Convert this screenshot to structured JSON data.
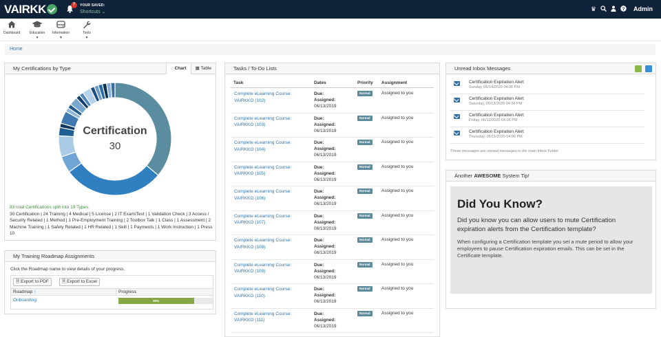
{
  "topbar": {
    "logo": "VAIRKK",
    "notif_count": "7",
    "saved_label": "YOUR SAVED:",
    "shortcuts_label": "Shortcuts",
    "user_name": "Admin"
  },
  "nav": {
    "items": [
      {
        "label": "Dashboard",
        "icon": "home-icon"
      },
      {
        "label": "Education",
        "icon": "graduation-cap-icon"
      },
      {
        "label": "Information",
        "icon": "drive-icon"
      },
      {
        "label": "Tools",
        "icon": "wrench-icon"
      }
    ]
  },
  "breadcrumb": {
    "home": "Home"
  },
  "certs": {
    "title": "My Certifications by Type",
    "tab_chart": "Chart",
    "tab_table": "Table",
    "center_label": "Certification",
    "center_value": "30",
    "summary_lead": "83 total Certifications split into 19 Types.",
    "summary_body": "30 Certification | 24 Training | 4 Medical | 5 License | 2 IT Exam/Test | 1 Validation Check | 3 Access / Security Related | 1 Method | 1 Pre-Employment Training | 2 Toolbox Talk | 1 Class | 1 Assessment | 2 Machine Training | 1 Safety Related | 1 HR Related | 1 Skill | 1 Payments | 1 Work Instruction | 1 Press 10"
  },
  "chart_data": {
    "type": "pie",
    "title": "",
    "categories": [
      "Certification",
      "Training",
      "Medical",
      "License",
      "IT Exam/Test",
      "Validation Check",
      "Access / Security Related",
      "Method",
      "Pre-Employment Training",
      "Toolbox Talk",
      "Class",
      "Assessment",
      "Machine Training",
      "Safety Related",
      "HR Related",
      "Skill",
      "Payments",
      "Work Instruction",
      "Press 10"
    ],
    "values": [
      30,
      24,
      4,
      5,
      2,
      1,
      3,
      1,
      1,
      2,
      1,
      1,
      2,
      1,
      1,
      1,
      1,
      1,
      1
    ],
    "colors": [
      "#5a8da0",
      "#2f7fc1",
      "#6ea5d4",
      "#a9cbe6",
      "#1f5f96",
      "#0e3a62",
      "#3f79b0",
      "#93b6d9",
      "#245a8c",
      "#7aa7cf",
      "#153f69",
      "#4f86bb",
      "#b6d2ea",
      "#1b4d7d",
      "#6a9bc9",
      "#2b6aa3",
      "#0c2f52",
      "#85aed6",
      "#3a6f9f"
    ]
  },
  "roadmap": {
    "title": "My Training Roadmap Assignments",
    "instructions": "Click the Roadmap name to view details of your progress.",
    "export_pdf": "Export to PDF",
    "export_excel": "Export to Excel",
    "col_roadmap": "Roadmap",
    "col_progress": "Progress",
    "row_name": "Onboarding",
    "row_progress": "80%",
    "row_progress_value": 0.8
  },
  "tasks": {
    "title": "Tasks / To-Do Lists",
    "col_task": "Task",
    "col_dates": "Dates",
    "col_priority": "Priority",
    "col_assignment": "Assignment",
    "due_label": "Due:",
    "assigned_label": "Assigned:",
    "rows": [
      {
        "name": "Complete eLearning Course: VAIRKKO (102)",
        "assigned": "06/13/2019",
        "priority": "Normal",
        "assignment": "Assigned to you"
      },
      {
        "name": "Complete eLearning Course: VAIRKKO (103)",
        "assigned": "06/13/2019",
        "priority": "Normal",
        "assignment": "Assigned to you"
      },
      {
        "name": "Complete eLearning Course: VAIRKKO (104)",
        "assigned": "06/13/2019",
        "priority": "Normal",
        "assignment": "Assigned to you"
      },
      {
        "name": "Complete eLearning Course: VAIRKKO (105)",
        "assigned": "06/13/2019",
        "priority": "Normal",
        "assignment": "Assigned to you"
      },
      {
        "name": "Complete eLearning Course: VAIRKKO (106)",
        "assigned": "06/13/2019",
        "priority": "Normal",
        "assignment": "Assigned to you"
      },
      {
        "name": "Complete eLearning Course: VAIRKKO (107)",
        "assigned": "06/13/2019",
        "priority": "Normal",
        "assignment": "Assigned to you"
      },
      {
        "name": "Complete eLearning Course: VAIRKKO (108)",
        "assigned": "06/13/2019",
        "priority": "Normal",
        "assignment": "Assigned to you"
      },
      {
        "name": "Complete eLearning Course: VAIRKKO (109)",
        "assigned": "06/13/2019",
        "priority": "Normal",
        "assignment": "Assigned to you"
      },
      {
        "name": "Complete eLearning Course: VAIRKKO (110)",
        "assigned": "06/13/2019",
        "priority": "Normal",
        "assignment": "Assigned to you"
      },
      {
        "name": "Complete eLearning Course: VAIRKKO (111)",
        "assigned": "06/13/2019",
        "priority": "Normal",
        "assignment": "Assigned to you"
      }
    ]
  },
  "inbox": {
    "title": "Unread Inbox Messages",
    "messages": [
      {
        "title": "Certification Expiration Alert",
        "date": "Sunday, 06/14/2020 04:06 PM"
      },
      {
        "title": "Certification Expiration Alert",
        "date": "Saturday, 06/13/2020 04:06 PM"
      },
      {
        "title": "Certification Expiration Alert",
        "date": "Friday, 06/12/2020 04:06 PM"
      },
      {
        "title": "Certification Expiration Alert",
        "date": "Thursday, 06/11/2020 04:06 PM"
      }
    ],
    "footer": "These messages are unread messages in the main Inbox Folder"
  },
  "tip": {
    "title_pre": "Another ",
    "title_brand": "AWESOME",
    "title_post": " System Tip!",
    "heading": "Did You Know?",
    "question": "Did you know you can allow users to mute Certification expiration alerts from the Certification template?",
    "body": "When configuring a Certification template you set a mute period to allow your employees to pause Certification expiration emails. This can be set in the Certificate template."
  }
}
